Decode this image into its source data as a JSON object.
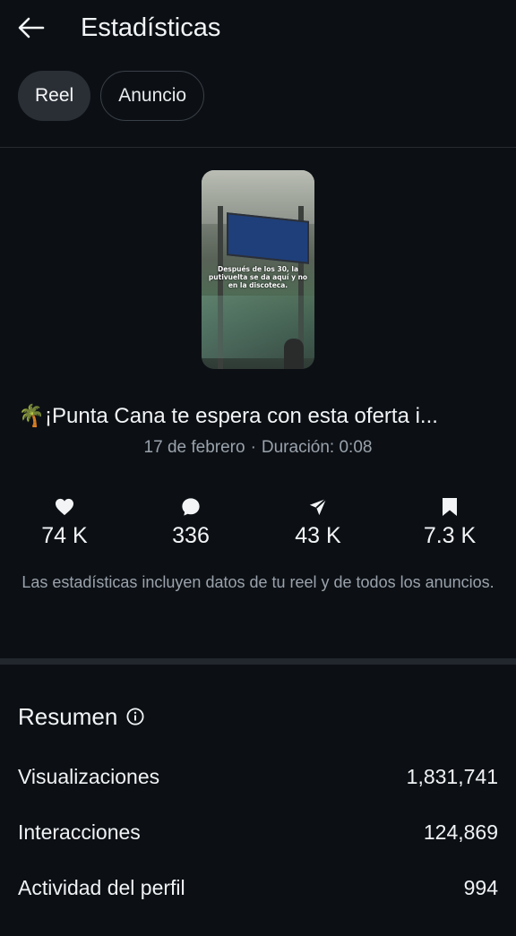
{
  "header": {
    "title": "Estadísticas",
    "back_icon": "arrow-left-icon"
  },
  "chips": [
    {
      "label": "Reel",
      "selected": true
    },
    {
      "label": "Anuncio",
      "selected": false
    }
  ],
  "thumbnail": {
    "caption": "Después de los 30, la putivuelta se da aquí y no en la discoteca."
  },
  "reel": {
    "emoji": "🌴",
    "title": "¡Punta Cana te espera con esta oferta i...",
    "date": "17 de febrero",
    "separator": "·",
    "duration": "Duración: 0:08"
  },
  "stats": [
    {
      "icon": "heart-icon",
      "value": "74 K"
    },
    {
      "icon": "comment-icon",
      "value": "336"
    },
    {
      "icon": "share-icon",
      "value": "43 K"
    },
    {
      "icon": "bookmark-icon",
      "value": "7.3 K"
    }
  ],
  "note": "Las estadísticas incluyen datos de tu reel y de todos los anuncios.",
  "summary": {
    "title": "Resumen",
    "rows": [
      {
        "label": "Visualizaciones",
        "value": "1,831,741"
      },
      {
        "label": "Interacciones",
        "value": "124,869"
      },
      {
        "label": "Actividad del perfil",
        "value": "994"
      }
    ]
  },
  "colors": {
    "background": "#0c1015",
    "text": "#f2f4f6",
    "muted": "#9aa2ab",
    "chip_active": "#2a2f36"
  }
}
